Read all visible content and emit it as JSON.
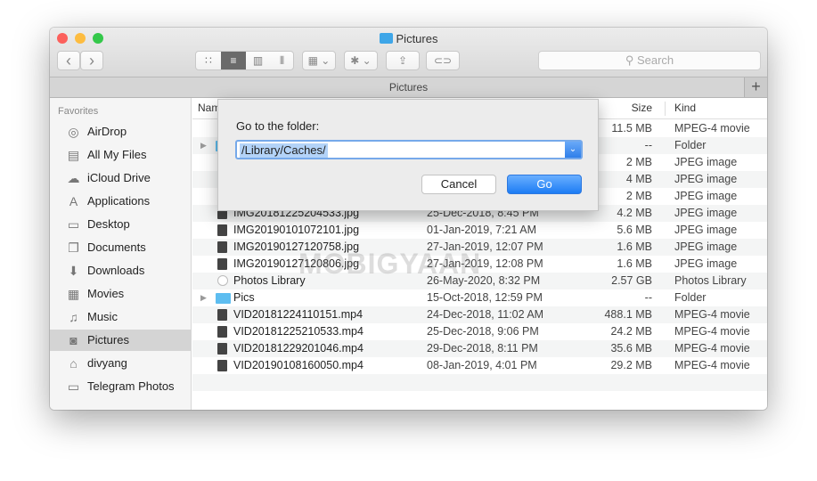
{
  "window": {
    "title": "Pictures",
    "tab_title": "Pictures",
    "search_placeholder": "Search",
    "new_tab": "+"
  },
  "colors": {
    "close": "#fc605c",
    "minimize": "#fdbc40",
    "zoom": "#34c84a",
    "accent": "#2f7fea",
    "folder": "#5dbdf0"
  },
  "toolbar": {
    "back": "‹",
    "forward": "›",
    "views": [
      "icon-view",
      "list-view",
      "column-view",
      "cover-flow-view"
    ],
    "active_view": "list-view",
    "group": "group-icon",
    "action": "gear-icon",
    "share": "share-icon",
    "tag": "tag-icon"
  },
  "sidebar": {
    "heading": "Favorites",
    "selected": "Pictures",
    "items": [
      {
        "label": "AirDrop",
        "icon": "◎"
      },
      {
        "label": "All My Files",
        "icon": "▤"
      },
      {
        "label": "iCloud Drive",
        "icon": "☁"
      },
      {
        "label": "Applications",
        "icon": "A"
      },
      {
        "label": "Desktop",
        "icon": "▭"
      },
      {
        "label": "Documents",
        "icon": "❐"
      },
      {
        "label": "Downloads",
        "icon": "⬇"
      },
      {
        "label": "Movies",
        "icon": "▦"
      },
      {
        "label": "Music",
        "icon": "♫"
      },
      {
        "label": "Pictures",
        "icon": "◙"
      },
      {
        "label": "divyang",
        "icon": "⌂"
      },
      {
        "label": "Telegram Photos",
        "icon": "▭"
      }
    ]
  },
  "columns": {
    "name": "Nam",
    "size": "Size",
    "kind": "Kind"
  },
  "files": [
    {
      "name": "",
      "date": "",
      "size": "11.5 MB",
      "kind": "MPEG-4 movie",
      "type": "video"
    },
    {
      "name": "",
      "date": "",
      "size": "--",
      "kind": "Folder",
      "type": "folder"
    },
    {
      "name": "",
      "date": "",
      "size": "2 MB",
      "kind": "JPEG image",
      "type": "image"
    },
    {
      "name": "",
      "date": "",
      "size": "4 MB",
      "kind": "JPEG image",
      "type": "image"
    },
    {
      "name": "",
      "date": "",
      "size": "2 MB",
      "kind": "JPEG image",
      "type": "image"
    },
    {
      "name": "IMG20181225204533.jpg",
      "date": "25-Dec-2018, 8:45 PM",
      "size": "4.2 MB",
      "kind": "JPEG image",
      "type": "image"
    },
    {
      "name": "IMG20190101072101.jpg",
      "date": "01-Jan-2019, 7:21 AM",
      "size": "5.6 MB",
      "kind": "JPEG image",
      "type": "image"
    },
    {
      "name": "IMG20190127120758.jpg",
      "date": "27-Jan-2019, 12:07 PM",
      "size": "1.6 MB",
      "kind": "JPEG image",
      "type": "image"
    },
    {
      "name": "IMG20190127120806.jpg",
      "date": "27-Jan-2019, 12:08 PM",
      "size": "1.6 MB",
      "kind": "JPEG image",
      "type": "image"
    },
    {
      "name": "Photos Library",
      "date": "26-May-2020, 8:32 PM",
      "size": "2.57 GB",
      "kind": "Photos Library",
      "type": "photos"
    },
    {
      "name": "Pics",
      "date": "15-Oct-2018, 12:59 PM",
      "size": "--",
      "kind": "Folder",
      "type": "folder"
    },
    {
      "name": "VID20181224110151.mp4",
      "date": "24-Dec-2018, 11:02 AM",
      "size": "488.1 MB",
      "kind": "MPEG-4 movie",
      "type": "video"
    },
    {
      "name": "VID20181225210533.mp4",
      "date": "25-Dec-2018, 9:06 PM",
      "size": "24.2 MB",
      "kind": "MPEG-4 movie",
      "type": "video"
    },
    {
      "name": "VID20181229201046.mp4",
      "date": "29-Dec-2018, 8:11 PM",
      "size": "35.6 MB",
      "kind": "MPEG-4 movie",
      "type": "video"
    },
    {
      "name": "VID20190108160050.mp4",
      "date": "08-Jan-2019, 4:01 PM",
      "size": "29.2 MB",
      "kind": "MPEG-4 movie",
      "type": "video"
    }
  ],
  "dialog": {
    "label": "Go to the folder:",
    "value": "/Library/Caches/",
    "cancel": "Cancel",
    "go": "Go"
  },
  "watermark": "MOBIGYAAN"
}
